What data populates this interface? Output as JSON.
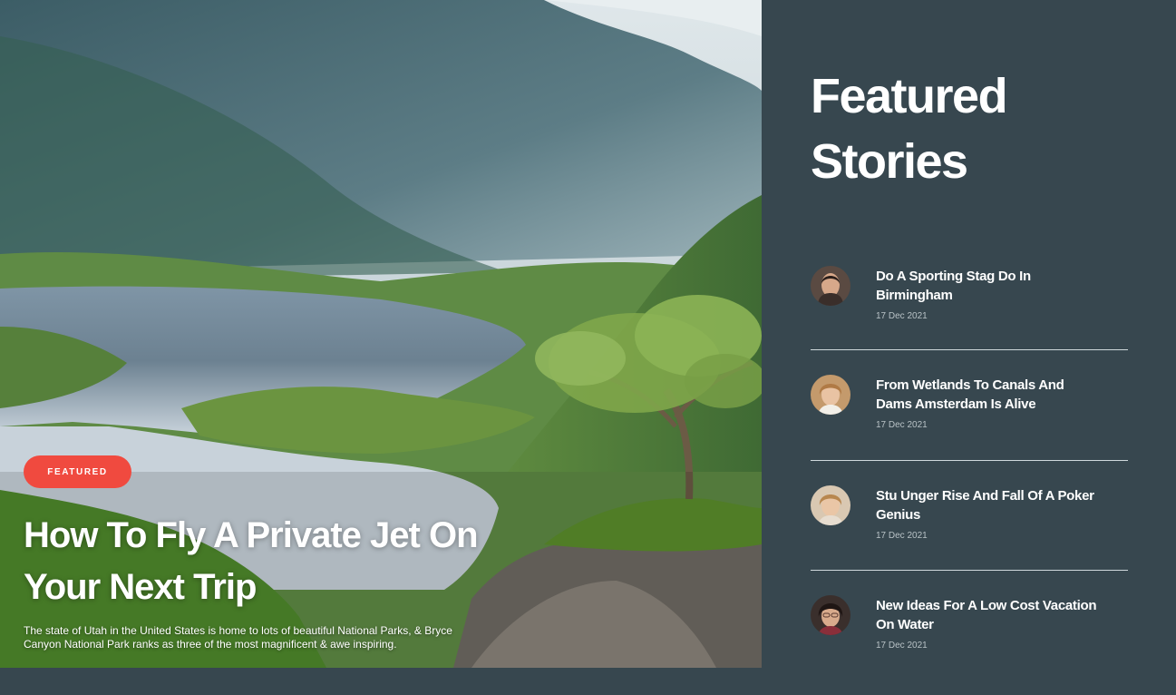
{
  "hero": {
    "badge": "FEATURED",
    "title": "How To Fly A Private Jet On Your Next Trip",
    "description": "The state of Utah in the United States is home to lots of beautiful National Parks, & Bryce Canyon National Park ranks as three of the most magnificent & awe inspiring."
  },
  "sidebar": {
    "title": "Featured Stories",
    "stories": [
      {
        "headline": "Do A Sporting Stag Do In Birmingham",
        "date": "17 Dec 2021"
      },
      {
        "headline": "From Wetlands To Canals And Dams Amsterdam Is Alive",
        "date": "17 Dec 2021"
      },
      {
        "headline": "Stu Unger Rise And Fall Of A Poker Genius",
        "date": "17 Dec 2021"
      },
      {
        "headline": "New Ideas For A Low Cost Vacation On Water",
        "date": "17 Dec 2021"
      }
    ]
  },
  "colors": {
    "sidebar_bg": "#37474f",
    "badge_bg": "#f04a3f",
    "text": "#ffffff",
    "date_text": "#b8c2c6"
  }
}
